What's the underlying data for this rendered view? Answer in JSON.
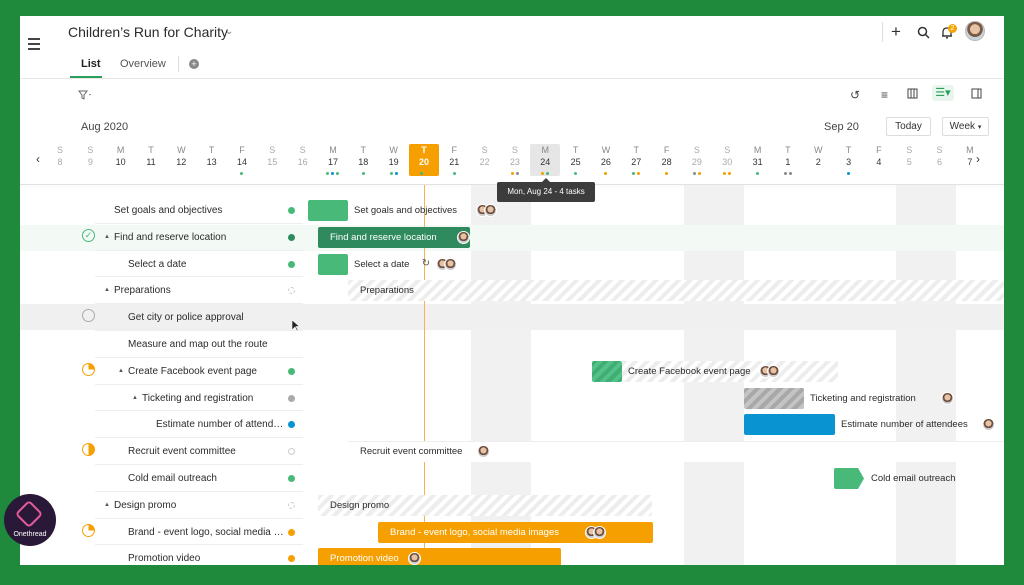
{
  "header": {
    "title": "Children’s Run for Charity",
    "tabs": [
      {
        "label": "List"
      },
      {
        "label": "Overview"
      }
    ],
    "notification_count": "2",
    "icons": [
      "menu-icon",
      "plus-icon",
      "search-icon",
      "bell-icon",
      "avatar"
    ]
  },
  "toolbar": {
    "icons": [
      "filter-icon",
      "undo-icon",
      "list-icon",
      "board-icon",
      "gantt-icon",
      "panel-icon"
    ]
  },
  "calendar": {
    "left_month": "Aug 2020",
    "right_month": "Sep 20",
    "today_button": "Today",
    "view_select": "Week",
    "days": [
      {
        "l": "S",
        "n": "8",
        "w": true
      },
      {
        "l": "S",
        "n": "9",
        "w": true
      },
      {
        "l": "M",
        "n": "10"
      },
      {
        "l": "T",
        "n": "11"
      },
      {
        "l": "W",
        "n": "12"
      },
      {
        "l": "T",
        "n": "13"
      },
      {
        "l": "F",
        "n": "14"
      },
      {
        "l": "S",
        "n": "15",
        "w": true
      },
      {
        "l": "S",
        "n": "16",
        "w": true
      },
      {
        "l": "M",
        "n": "17"
      },
      {
        "l": "T",
        "n": "18"
      },
      {
        "l": "W",
        "n": "19"
      },
      {
        "l": "T",
        "n": "20",
        "today": true
      },
      {
        "l": "F",
        "n": "21"
      },
      {
        "l": "S",
        "n": "22",
        "w": true
      },
      {
        "l": "S",
        "n": "23",
        "w": true
      },
      {
        "l": "M",
        "n": "24",
        "hover": true
      },
      {
        "l": "T",
        "n": "25"
      },
      {
        "l": "W",
        "n": "26"
      },
      {
        "l": "T",
        "n": "27"
      },
      {
        "l": "F",
        "n": "28"
      },
      {
        "l": "S",
        "n": "29",
        "w": true
      },
      {
        "l": "S",
        "n": "30",
        "w": true
      },
      {
        "l": "M",
        "n": "31"
      },
      {
        "l": "T",
        "n": "1"
      },
      {
        "l": "W",
        "n": "2"
      },
      {
        "l": "T",
        "n": "3"
      },
      {
        "l": "F",
        "n": "4"
      },
      {
        "l": "S",
        "n": "5",
        "w": true
      },
      {
        "l": "S",
        "n": "6",
        "w": true
      },
      {
        "l": "M",
        "n": "7"
      }
    ],
    "tooltip": "Mon, Aug 24 - 4 tasks"
  },
  "colors": {
    "brand_green": "#1f8a3b",
    "status_green": "#49b97a",
    "status_dark_green": "#2f8a5e",
    "status_blue": "#0a93d1",
    "status_orange": "#f5a000",
    "today_orange": "#f5a000"
  },
  "tasks": [
    {
      "name": "Set goals and objectives",
      "indent": 0,
      "dot": "green",
      "bar_label": "Set goals and objectives"
    },
    {
      "name": "Find and reserve location",
      "indent": 0,
      "dot": "dark-green",
      "expanded": true,
      "checked": true,
      "bar_label": "Find and reserve location"
    },
    {
      "name": "Select a date",
      "indent": 1,
      "dot": "green",
      "bar_label": "Select a date"
    },
    {
      "name": "Preparations",
      "indent": 0,
      "dot": "hatch",
      "expanded": true,
      "bar_label": "Preparations"
    },
    {
      "name": "Get city or police approval",
      "indent": 1,
      "dot": "none",
      "circle": "empty"
    },
    {
      "name": "Measure and map out the route",
      "indent": 1,
      "dot": "none"
    },
    {
      "name": "Create Facebook event page",
      "indent": 1,
      "dot": "green",
      "expanded": true,
      "circle": "orange",
      "bar_label": "Create Facebook event page"
    },
    {
      "name": "Ticketing and registration",
      "indent": 2,
      "dot": "gray",
      "expanded": true,
      "bar_label": "Ticketing and registration"
    },
    {
      "name": "Estimate number of attendees",
      "indent": 3,
      "dot": "blue",
      "bar_label": "Estimate number of attendees"
    },
    {
      "name": "Recruit event committee",
      "indent": 1,
      "dot": "empty",
      "circle": "orange-half",
      "bar_label": "Recruit event committee"
    },
    {
      "name": "Cold email outreach",
      "indent": 1,
      "dot": "green",
      "bar_label": "Cold email outreach"
    },
    {
      "name": "Design promo",
      "indent": 0,
      "dot": "hatch",
      "expanded": true,
      "bar_label": "Design promo"
    },
    {
      "name": "Brand - event logo, social media images",
      "indent": 1,
      "dot": "orange",
      "circle": "orange",
      "bar_label": "Brand - event logo, social media images"
    },
    {
      "name": "Promotion video",
      "indent": 1,
      "dot": "orange",
      "bar_label": "Promotion video"
    }
  ],
  "logo": {
    "text": "Onethread"
  }
}
